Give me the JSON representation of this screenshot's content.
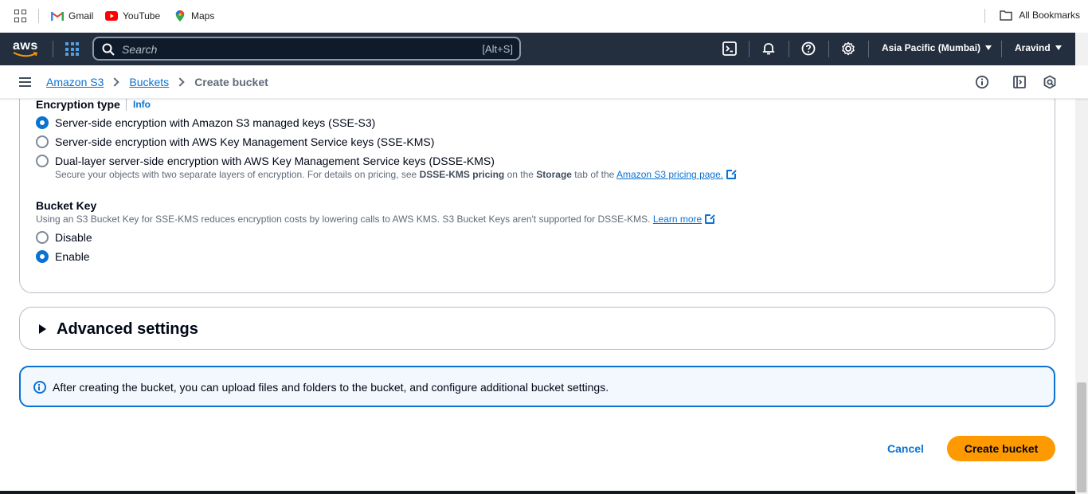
{
  "bookmarks": {
    "items": [
      {
        "label": "Gmail",
        "icon": "gmail-icon"
      },
      {
        "label": "YouTube",
        "icon": "youtube-icon"
      },
      {
        "label": "Maps",
        "icon": "maps-icon"
      }
    ],
    "all_bookmarks": "All Bookmarks"
  },
  "nav": {
    "logo": "aws",
    "search_placeholder": "Search",
    "search_shortcut": "[Alt+S]",
    "region": "Asia Pacific (Mumbai)",
    "user": "Aravind"
  },
  "breadcrumb": {
    "items": [
      "Amazon S3",
      "Buckets"
    ],
    "current": "Create bucket"
  },
  "encryption": {
    "label": "Encryption type",
    "info": "Info",
    "options": [
      {
        "label": "Server-side encryption with Amazon S3 managed keys (SSE-S3)",
        "selected": true
      },
      {
        "label": "Server-side encryption with AWS Key Management Service keys (SSE-KMS)",
        "selected": false
      },
      {
        "label": "Dual-layer server-side encryption with AWS Key Management Service keys (DSSE-KMS)",
        "selected": false
      }
    ],
    "dsse_desc_1": "Secure your objects with two separate layers of encryption. For details on pricing, see ",
    "dsse_desc_bold1": "DSSE-KMS pricing",
    "dsse_desc_2": " on the ",
    "dsse_desc_bold2": "Storage",
    "dsse_desc_3": " tab of the ",
    "dsse_desc_link": "Amazon S3 pricing page."
  },
  "bucket_key": {
    "label": "Bucket Key",
    "desc": "Using an S3 Bucket Key for SSE-KMS reduces encryption costs by lowering calls to AWS KMS. S3 Bucket Keys aren't supported for DSSE-KMS. ",
    "learn_more": "Learn more",
    "options": [
      {
        "label": "Disable",
        "selected": false
      },
      {
        "label": "Enable",
        "selected": true
      }
    ]
  },
  "advanced": {
    "title": "Advanced settings"
  },
  "alert": {
    "text": "After creating the bucket, you can upload files and folders to the bucket, and configure additional bucket settings."
  },
  "actions": {
    "cancel": "Cancel",
    "create": "Create bucket"
  },
  "colors": {
    "accent": "#0972d3",
    "primary_button": "#ff9900",
    "nav_bg": "#232f3e"
  }
}
